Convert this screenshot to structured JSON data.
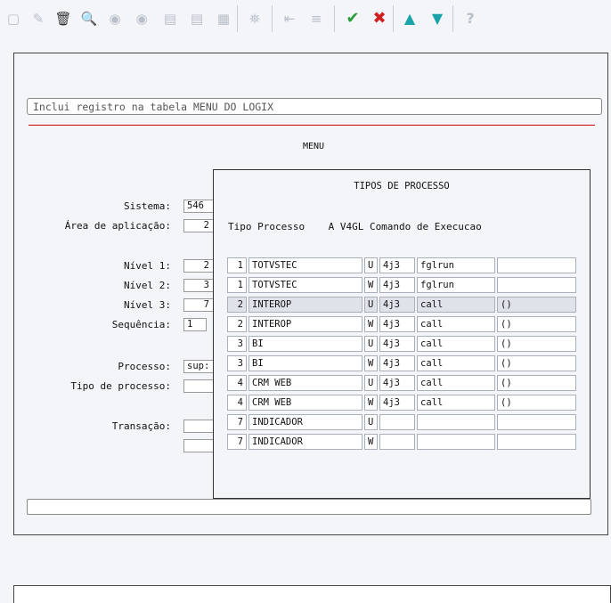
{
  "toolbar": {
    "icons": [
      "new-icon",
      "edit-icon",
      "delete-icon",
      "find-icon",
      "previous-icon",
      "next-icon",
      "print-icon",
      "print-preview-icon",
      "export-icon",
      "binoculars-icon",
      "first-icon",
      "list-icon",
      "confirm-icon",
      "cancel-icon",
      "up-icon",
      "down-icon",
      "help-icon"
    ]
  },
  "status": {
    "message": "Inclui registro na tabela MENU DO LOGIX"
  },
  "form": {
    "title": "MENU",
    "sistema_label": "Sistema:",
    "sistema_value": "546",
    "area_label": "Área de aplicação:",
    "area_value": "2",
    "nivel1_label": "Nível 1:",
    "nivel1_value": "2",
    "nivel2_label": "Nível 2:",
    "nivel2_value": "3",
    "nivel3_label": "Nível 3:",
    "nivel3_value": "7",
    "sequencia_label": "Sequência:",
    "sequencia_value": "1",
    "processo_label": "Processo:",
    "processo_value": "sup:",
    "tipo_processo_label": "Tipo de processo:",
    "transacao_label": "Transação:"
  },
  "popup": {
    "title": "TIPOS DE PROCESSO",
    "header": "Tipo Processo    A V4GL Comando de Execucao",
    "rows": [
      {
        "num": "1",
        "tipo": "TOTVSTEC",
        "a": "U",
        "v4gl": "4j3",
        "cmd": "fglrun",
        "args": ""
      },
      {
        "num": "1",
        "tipo": "TOTVSTEC",
        "a": "W",
        "v4gl": "4j3",
        "cmd": "fglrun",
        "args": ""
      },
      {
        "num": "2",
        "tipo": "INTEROP",
        "a": "U",
        "v4gl": "4j3",
        "cmd": "call",
        "args": "()"
      },
      {
        "num": "2",
        "tipo": "INTEROP",
        "a": "W",
        "v4gl": "4j3",
        "cmd": "call",
        "args": "()"
      },
      {
        "num": "3",
        "tipo": "BI",
        "a": "U",
        "v4gl": "4j3",
        "cmd": "call",
        "args": "()"
      },
      {
        "num": "3",
        "tipo": "BI",
        "a": "W",
        "v4gl": "4j3",
        "cmd": "call",
        "args": "()"
      },
      {
        "num": "4",
        "tipo": "CRM WEB",
        "a": "U",
        "v4gl": "4j3",
        "cmd": "call",
        "args": "()"
      },
      {
        "num": "4",
        "tipo": "CRM WEB",
        "a": "W",
        "v4gl": "4j3",
        "cmd": "call",
        "args": "()"
      },
      {
        "num": "7",
        "tipo": "INDICADOR",
        "a": "U",
        "v4gl": "",
        "cmd": "",
        "args": ""
      },
      {
        "num": "7",
        "tipo": "INDICADOR",
        "a": "W",
        "v4gl": "",
        "cmd": "",
        "args": ""
      }
    ],
    "selected_row": 2
  },
  "colors": {
    "accent_line": "#cc0000",
    "confirm": "#2a9d3a",
    "cancel": "#d02020",
    "nav": "#1aa3a8"
  }
}
